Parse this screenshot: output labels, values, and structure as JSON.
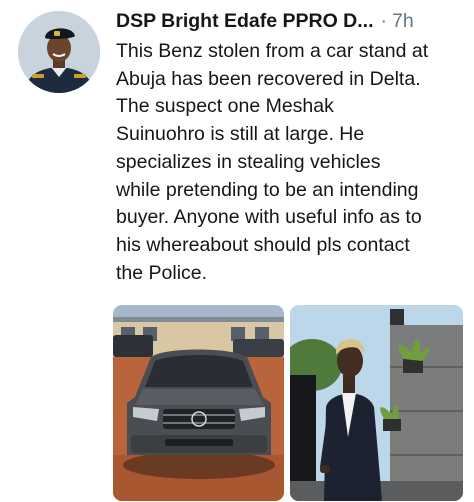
{
  "tweet": {
    "author_name": "DSP Bright Edafe PPRO D...",
    "separator": "·",
    "timestamp": "7h",
    "text": "This Benz stolen from a car stand at\nAbuja has been recovered in Delta.\nThe suspect  one Meshak\nSuinuohro is still at large. He\nspecializes in stealing vehicles\nwhile pretending to be an intending\nbuyer. Anyone with useful info as to\nhis whereabout should pls contact\nthe Police."
  },
  "media": {
    "photos": [
      {
        "icon": "car-photo"
      },
      {
        "icon": "suspect-photo"
      }
    ]
  },
  "colors": {
    "name": "#14171a",
    "meta": "#657786",
    "background": "#ffffff"
  }
}
